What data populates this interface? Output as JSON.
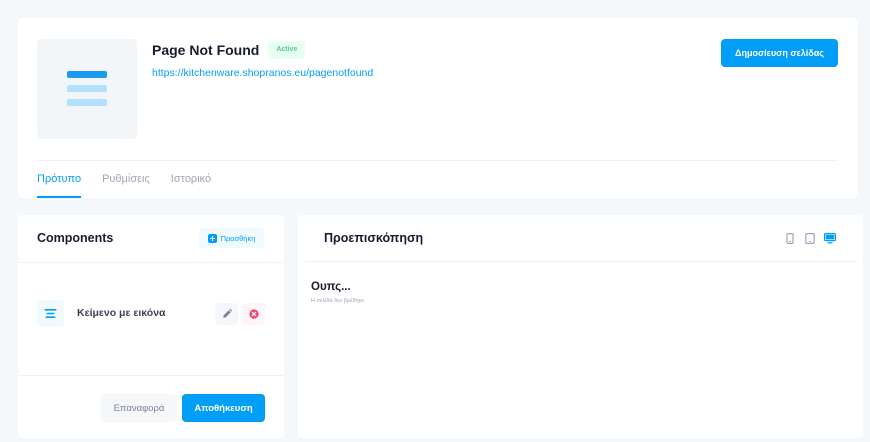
{
  "page": {
    "title": "Page Not Found",
    "status_badge": "Active",
    "url": "https://kitchenware.shopranos.eu/pagenotfound",
    "publish_button": "Δημοσίευση σελίδας",
    "thumbnail_icon": "page-layout-icon"
  },
  "tabs": [
    {
      "label": "Πρότυπο",
      "active": true
    },
    {
      "label": "Ρυθμίσεις",
      "active": false
    },
    {
      "label": "Ιστορικό",
      "active": false
    }
  ],
  "components_panel": {
    "title": "Components",
    "add_button": "Προσθήκη",
    "add_icon": "plus-icon",
    "items": [
      {
        "label": "Κείμενο με εικόνα",
        "icon": "text-align-center-icon",
        "actions": [
          "pencil-icon",
          "remove-circle-icon"
        ]
      }
    ],
    "reset_button": "Επαναφορά",
    "save_button": "Αποθήκευση"
  },
  "preview_panel": {
    "title": "Προεπισκόπηση",
    "devices": [
      {
        "icon": "mobile-icon",
        "active": false
      },
      {
        "icon": "tablet-icon",
        "active": false
      },
      {
        "icon": "desktop-icon",
        "active": true
      }
    ],
    "heading": "Ουπς...",
    "message": "Η σελίδα δεν βρέθηκε"
  },
  "colors": {
    "primary": "#009ef7",
    "primary_light": "#f1faff",
    "success": "#50cd89",
    "success_light": "#e8fff3",
    "danger": "#f1416c",
    "danger_light": "#fff5f8",
    "background": "#f5f8fa",
    "muted_text": "#a1a5b7"
  }
}
